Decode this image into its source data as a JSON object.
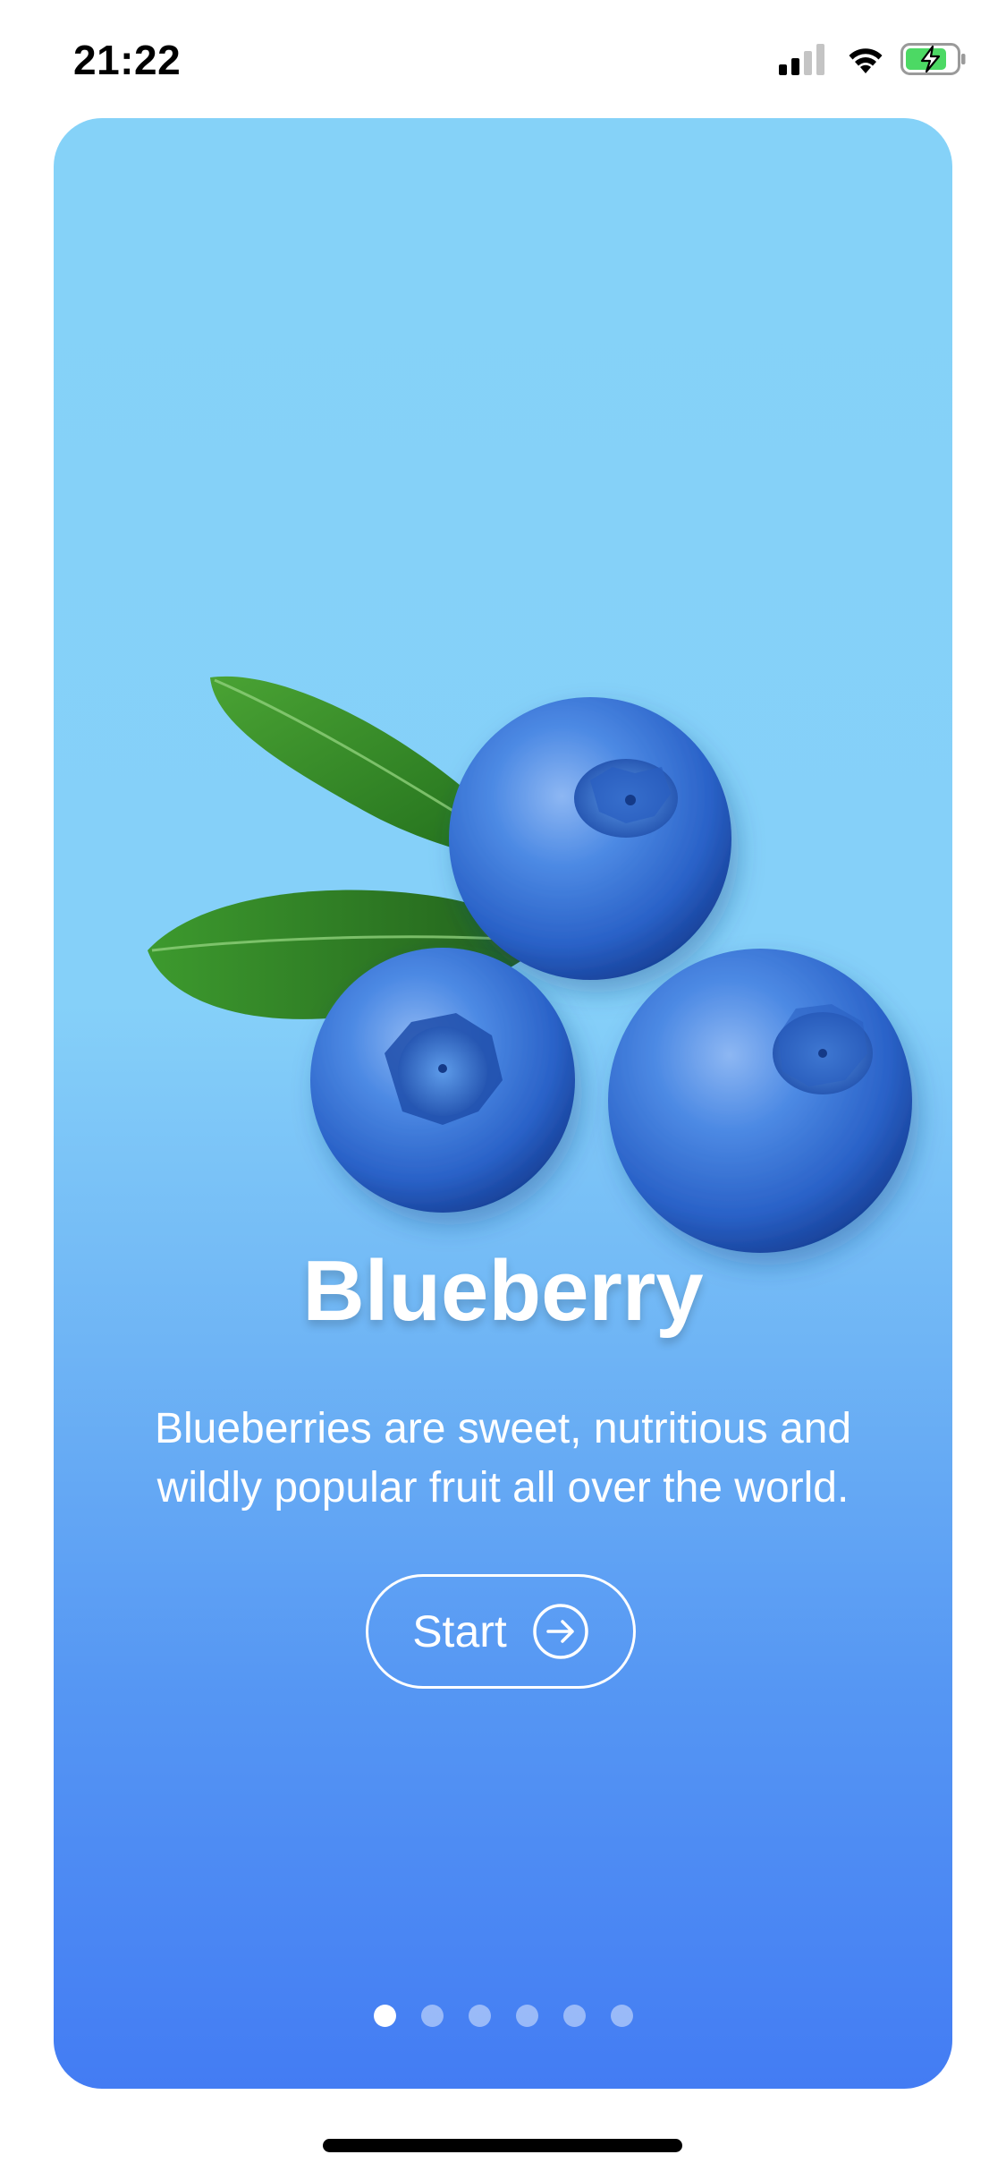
{
  "status_bar": {
    "time": "21:22",
    "icons": [
      "cellular-signal-icon",
      "wifi-icon",
      "battery-charging-icon"
    ],
    "battery_color": "#4cd964"
  },
  "card": {
    "gradient_top": "#85d2f8",
    "gradient_bottom": "#437cf3",
    "image": "blueberries-with-leaves",
    "title": "Blueberry",
    "description": "Blueberries are sweet, nutritious and wildly popular fruit all over the world.",
    "button": {
      "label": "Start",
      "icon": "arrow-right-circle-icon"
    },
    "pager": {
      "total": 6,
      "active_index": 0
    }
  }
}
